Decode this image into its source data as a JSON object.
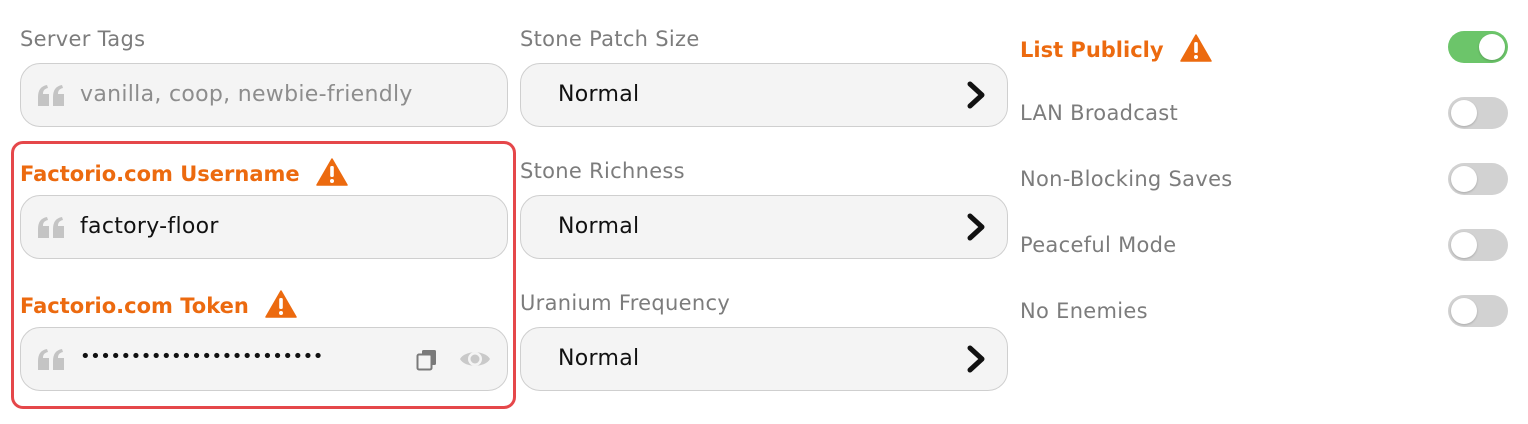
{
  "server_tags": {
    "label": "Server Tags",
    "placeholder": "vanilla, coop, newbie-friendly",
    "icon": "quote-icon"
  },
  "factorio_username": {
    "label": "Factorio.com Username",
    "value": "factory-floor",
    "icon": "quote-icon",
    "warning_icon": "warning-icon"
  },
  "factorio_token": {
    "label": "Factorio.com Token",
    "value": "••••••••••••••••••••••••",
    "icon": "quote-icon",
    "warning_icon": "warning-icon",
    "actions": [
      "copy-icon",
      "eye-icon"
    ]
  },
  "stone_patch_size": {
    "label": "Stone Patch Size",
    "value": "Normal"
  },
  "stone_richness": {
    "label": "Stone Richness",
    "value": "Normal"
  },
  "uranium_frequency": {
    "label": "Uranium Frequency",
    "value": "Normal"
  },
  "toggles": [
    {
      "label": "List Publicly",
      "on": true,
      "warning": true
    },
    {
      "label": "LAN Broadcast",
      "on": false,
      "warning": false
    },
    {
      "label": "Non-Blocking Saves",
      "on": false,
      "warning": false
    },
    {
      "label": "Peaceful Mode",
      "on": false,
      "warning": false
    },
    {
      "label": "No Enemies",
      "on": false,
      "warning": false
    }
  ],
  "colors": {
    "warning": "#ec6a0f",
    "toggle_on": "#6cc56a",
    "toggle_off": "#d2d2d2",
    "highlight": "#e5474a"
  }
}
